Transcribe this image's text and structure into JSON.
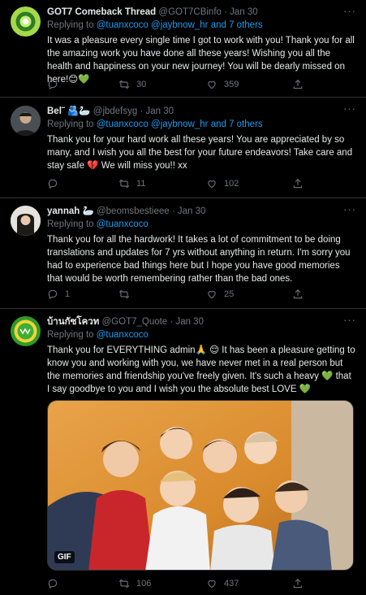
{
  "colors": {
    "background": "#000000",
    "text": "#e7e9ea",
    "muted": "#71767b",
    "link": "#1d9bf0",
    "divider": "#2f3336"
  },
  "tweets": [
    {
      "name": "GOT7 Comeback Thread",
      "handle": "@GOT7CBinfo",
      "date": "· Jan 30",
      "replying_prefix": "Replying to ",
      "replying_to": "@tuanxcoco @jaybnow_hr and 7 others",
      "text": "It was a pleasure every single time I got to work with you! Thank you for all the amazing work you have done all these years! Wishing you all the health and happiness on your new journey! You will be dearly missed on here!😊💚",
      "reply_count": "",
      "retweet_count": "30",
      "like_count": "359",
      "avatar_icon": "green-circle-logo-avatar"
    },
    {
      "name": "Bel˜ 🫂🦢",
      "handle": "@jbdefsyg",
      "date": "· Jan 30",
      "replying_prefix": "Replying to ",
      "replying_to": "@tuanxcoco @jaybnow_hr and 7 others",
      "text": "Thank you for your hard work all these years! You are appreciated by so many, and I wish you all the best for your future endeavors! Take care and stay safe 💔 We will miss you!! xx",
      "reply_count": "",
      "retweet_count": "11",
      "like_count": "102",
      "avatar_icon": "person-photo-avatar"
    },
    {
      "name": "yannah 🦢",
      "handle": "@beomsbestieee",
      "date": "· Jan 30",
      "replying_prefix": "Replying to ",
      "replying_to": "@tuanxcoco",
      "text": "Thank you for all the hardwork! It takes a lot of commitment to be doing translations and updates for 7 yrs without anything in return. I'm sorry you had to experience bad things here but I hope you have good memories that would be worth remembering rather than the bad ones.",
      "reply_count": "1",
      "retweet_count": "",
      "like_count": "25",
      "avatar_icon": "person-photo-avatar"
    },
    {
      "name": "บ้านกัซโควท",
      "handle": "@GOT7_Quote",
      "date": "· Jan 30",
      "replying_prefix": "Replying to ",
      "replying_to": "@tuanxcoco",
      "text": "Thank you for EVERYTHING admin🙏 😌 It has been a pleasure getting to know you and working with you, we have never met in a real person but the memories and friendship you've freely given. It's such a heavy 💚 that I say goodbye to you and I wish you the absolute best LOVE 💚",
      "reply_count": "",
      "retweet_count": "106",
      "like_count": "437",
      "avatar_icon": "got7-quote-logo-avatar",
      "media_badge": "GIF"
    }
  ]
}
